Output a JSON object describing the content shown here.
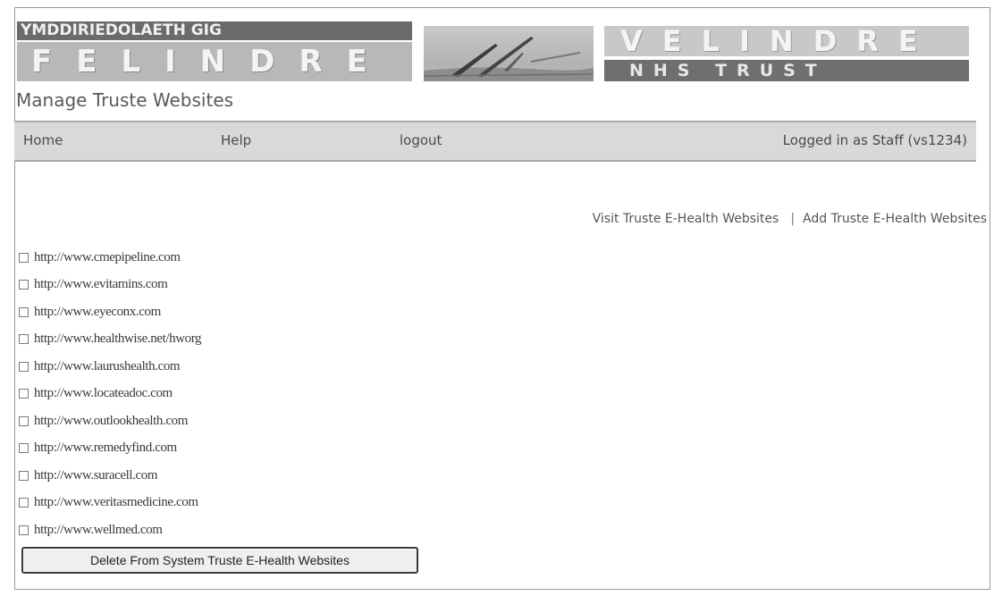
{
  "banner": {
    "welsh_line1": "YMDDIRIEDOLAETH GIG",
    "welsh_line2": "FELINDRE",
    "english_line1": "VELINDRE",
    "english_line2": "NHS TRUST"
  },
  "page": {
    "title": "Manage Truste Websites"
  },
  "nav": {
    "home": "Home",
    "help": "Help",
    "logout": "logout",
    "logged_in": "Logged in as Staff (vs1234)"
  },
  "links": {
    "visit": "Visit Truste E-Health Websites",
    "separator": "|",
    "add": "Add Truste E-Health Websites"
  },
  "sites": [
    "http://www.cmepipeline.com",
    "http://www.evitamins.com",
    "http://www.eyeconx.com",
    "http://www.healthwise.net/hworg",
    "http://www.laurushealth.com",
    "http://www.locateadoc.com",
    "http://www.outlookhealth.com",
    "http://www.remedyfind.com",
    "http://www.suracell.com",
    "http://www.veritasmedicine.com",
    "http://www.wellmed.com"
  ],
  "actions": {
    "delete_button": "Delete From System Truste E-Health Websites"
  },
  "colors": {
    "navbar_bg": "#d9d9d9",
    "banner_dark": "#6b6b6b",
    "banner_light": "#b8b8b8"
  }
}
